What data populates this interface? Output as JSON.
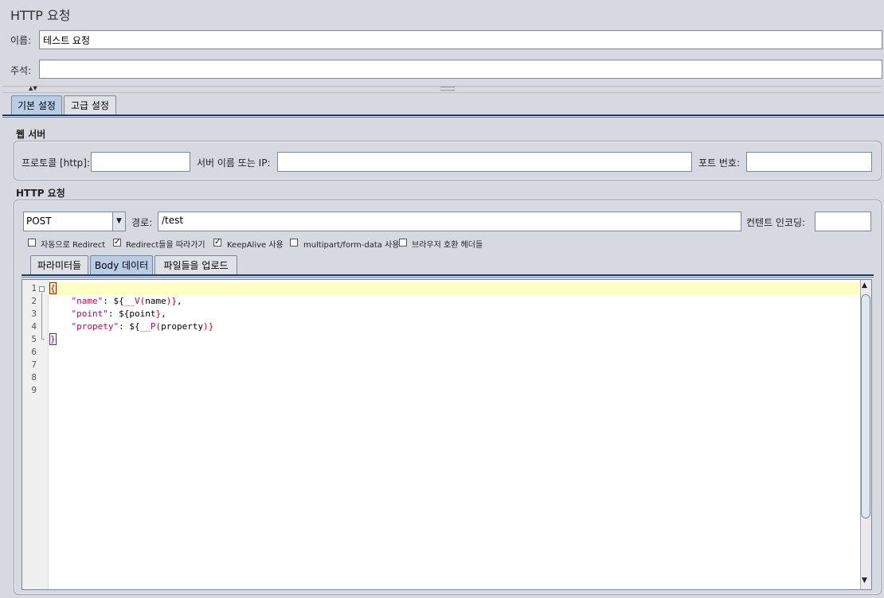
{
  "header": {
    "title": "HTTP 요청"
  },
  "name_field": {
    "label": "이름:",
    "value": "테스트 요청"
  },
  "comment_field": {
    "label": "주석:",
    "value": ""
  },
  "tabs": [
    {
      "label": "기본 설정"
    },
    {
      "label": "고급 설정"
    }
  ],
  "web_server": {
    "title": "웹 서버",
    "protocol_label": "프로토콜 [http]:",
    "protocol_value": "",
    "server_label": "서버 이름 또는 IP:",
    "server_value": "",
    "port_label": "포트 번호:",
    "port_value": ""
  },
  "http_request": {
    "title": "HTTP 요청",
    "method": "POST",
    "path_label": "경로:",
    "path_value": "/test",
    "encoding_label": "컨텐트 인코딩:",
    "encoding_value": ""
  },
  "options": [
    {
      "label": "자동으로 Redirect",
      "checked": false
    },
    {
      "label": "Redirect들을 따라가기",
      "checked": true
    },
    {
      "label": "KeepAlive 사용",
      "checked": true
    },
    {
      "label": "multipart/form-data 사용",
      "checked": false
    },
    {
      "label": "브라우저 호환 헤더들",
      "checked": false
    }
  ],
  "sub_tabs": [
    {
      "label": "파라미터들"
    },
    {
      "label": "Body 데이터"
    },
    {
      "label": "파일들을 업로드"
    }
  ],
  "editor": {
    "line_numbers": [
      "1",
      "2",
      "3",
      "4",
      "5",
      "6",
      "7",
      "8",
      "9"
    ],
    "lines": [
      {
        "k": "",
        "pre": "{"
      },
      {
        "key": "\"name\"",
        "mid": ": ${",
        "fn": "__V",
        "arg": "name",
        "end": "},"
      },
      {
        "key": "\"point\"",
        "mid": ": ${",
        "var": "point",
        "end": "},"
      },
      {
        "key": "\"propety\"",
        "mid": ": ${",
        "fn": "__P",
        "arg": "property",
        "end": "}"
      },
      {
        "k": "",
        "pre": "}"
      }
    ]
  }
}
